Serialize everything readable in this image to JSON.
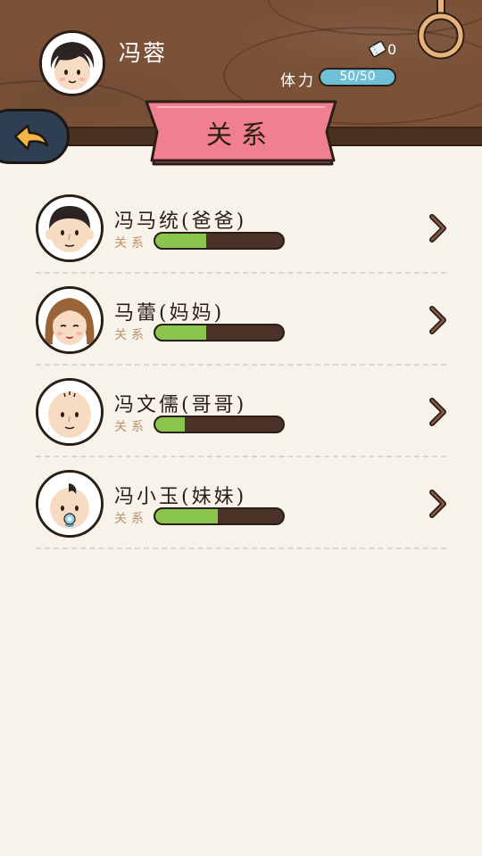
{
  "player": {
    "name": "冯蓉",
    "ticket_count": "0",
    "stamina_label": "体力",
    "stamina_value": "50/50"
  },
  "page_title": "关系",
  "colors": {
    "wood": "#7b5238",
    "banner": "#f07f8f",
    "stamina": "#6ec0d6",
    "relation_fill": "#8ac54f",
    "relation_track": "#4a3228",
    "back_button": "#2f3f52",
    "back_arrow": "#f3b548"
  },
  "relations": [
    {
      "name": "冯马统(爸爸)",
      "label": "关系",
      "level": 0.4,
      "avatar": "father-avatar-icon"
    },
    {
      "name": "马蕾(妈妈)",
      "label": "关系",
      "level": 0.4,
      "avatar": "mother-avatar-icon"
    },
    {
      "name": "冯文儒(哥哥)",
      "label": "关系",
      "level": 0.23,
      "avatar": "brother-avatar-icon"
    },
    {
      "name": "冯小玉(妹妹)",
      "label": "关系",
      "level": 0.49,
      "avatar": "sister-avatar-icon"
    }
  ]
}
